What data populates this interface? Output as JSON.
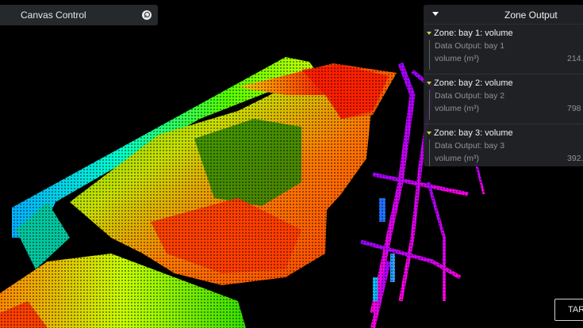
{
  "canvas_control": {
    "title": "Canvas Control",
    "search_icon": "search-icon"
  },
  "zone_output": {
    "title": "Zone Output",
    "collapse_icon": "caret-down-icon",
    "zones": [
      {
        "title": "Zone: bay 1: volume",
        "data_output": "Data Output: bay 1",
        "metric_label": "volume (m³)",
        "value": "214."
      },
      {
        "title": "Zone: bay 2: volume",
        "data_output": "Data Output: bay 2",
        "metric_label": "volume (m³)",
        "value": "798"
      },
      {
        "title": "Zone: bay 3: volume",
        "data_output": "Data Output: bay 3",
        "metric_label": "volume (m³)",
        "value": "392."
      }
    ],
    "caret_color": "#c9d24a"
  },
  "bottom_button": {
    "label": "TAR"
  },
  "colors": {
    "background": "#000000",
    "panel": "#22242a",
    "pointcloud_high": "#ff2a00",
    "pointcloud_mid": "#33e000",
    "pointcloud_low": "#00a0ff",
    "structure": "#d000ff"
  }
}
